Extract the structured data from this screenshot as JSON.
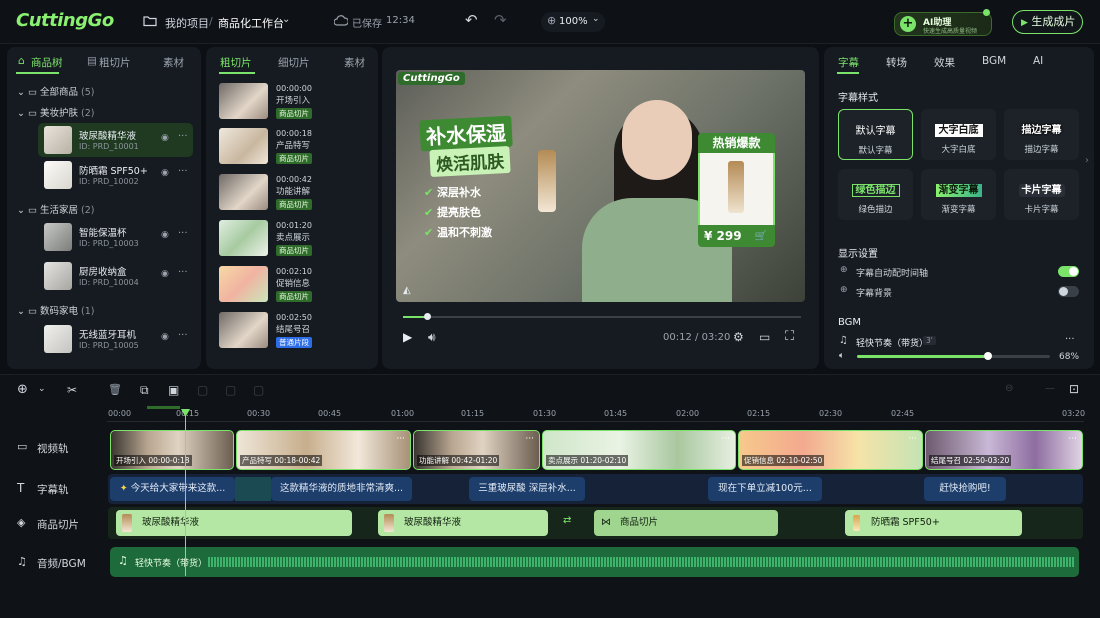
{
  "app": {
    "logo": "CuttingGo"
  },
  "topbar": {
    "project": "我的项目",
    "separator": "/",
    "workspace": "商品化工作台",
    "save_status": "已保存",
    "save_time": "12:34",
    "zoom": "100%",
    "ai_button_title": "AI助理",
    "ai_button_sub": "快速生成高质量视频",
    "generate_label": "生成成片"
  },
  "left_panel": {
    "tabs": [
      "商品树",
      "粗切片",
      "素材"
    ],
    "tree": [
      {
        "label": "全部商品",
        "count": "(5)"
      },
      {
        "label": "美妆护肤",
        "count": "(2)"
      },
      {
        "label": "生活家居",
        "count": "(2)"
      },
      {
        "label": "数码家电",
        "count": "(1)"
      }
    ],
    "products": [
      {
        "name": "玻尿酸精华液",
        "id": "ID: PRD_10001"
      },
      {
        "name": "防晒霜 SPF50+",
        "id": "ID: PRD_10002"
      },
      {
        "name": "智能保温杯",
        "id": "ID: PRD_10003"
      },
      {
        "name": "厨房收纳盒",
        "id": "ID: PRD_10004"
      },
      {
        "name": "无线蓝牙耳机",
        "id": "ID: PRD_10005"
      }
    ]
  },
  "clip_panel": {
    "tabs": [
      "粗切片",
      "细切片",
      "素材"
    ],
    "clips": [
      {
        "time": "00:00:00",
        "desc": "开场引入",
        "tag": "商品切片"
      },
      {
        "time": "00:00:18",
        "desc": "产品特写",
        "tag": "商品切片"
      },
      {
        "time": "00:00:42",
        "desc": "功能讲解",
        "tag": "商品切片"
      },
      {
        "time": "00:01:20",
        "desc": "卖点展示",
        "tag": "商品切片"
      },
      {
        "time": "00:02:10",
        "desc": "促销信息",
        "tag": "商品切片"
      },
      {
        "time": "00:02:50",
        "desc": "结尾号召",
        "tag": "普通片段"
      }
    ]
  },
  "preview": {
    "watermark": "CuttingGo",
    "headline1": "补水保湿",
    "headline2": "焕活肌肤",
    "bullets": [
      "深层补水",
      "提亮肤色",
      "温和不刺激"
    ],
    "hot_label": "热销爆款",
    "price": "¥ 299",
    "current_time": "00:12",
    "total_time": "03:20",
    "progress": 0.06
  },
  "right_panel": {
    "tabs": [
      "字幕",
      "转场",
      "效果",
      "BGM",
      "AI"
    ],
    "style_section": "字幕样式",
    "styles": [
      {
        "big": "默认字幕",
        "small": "默认字幕"
      },
      {
        "big": "大字白底",
        "small": "大字白底"
      },
      {
        "big": "描边字幕",
        "small": "描边字幕"
      },
      {
        "big": "绿色描边",
        "small": "绿色描边"
      },
      {
        "big": "渐变字幕",
        "small": "渐变字幕"
      },
      {
        "big": "卡片字幕",
        "small": "卡片字幕"
      }
    ],
    "display_section": "显示设置",
    "settings": [
      {
        "label": "字幕自动配时间轴",
        "on": true
      },
      {
        "label": "字幕背景",
        "on": false
      }
    ],
    "bgm_section": "BGM",
    "bgm_name": "轻快节奏（带货）",
    "bgm_duration": "3'",
    "volume": "68%"
  },
  "timeline": {
    "ticks": [
      "00:00",
      "00:15",
      "00:30",
      "00:45",
      "01:00",
      "01:15",
      "01:30",
      "01:45",
      "02:00",
      "02:15",
      "02:30",
      "02:45",
      "03:20"
    ],
    "tracks": [
      "视频轨",
      "字幕轨",
      "商品切片",
      "音频/BGM"
    ],
    "video_segments": [
      {
        "label": "开场引入 00:00-0:18"
      },
      {
        "label": "产品特写 00:18-00:42"
      },
      {
        "label": "功能讲解 00:42-01:20"
      },
      {
        "label": "卖点展示 01:20-02:10"
      },
      {
        "label": "促销信息 02:10-02:50"
      },
      {
        "label": "结尾号召 02:50-03:20"
      }
    ],
    "subtitles": [
      "今天给大家带来这款...",
      "这款精华液的质地非常清爽...",
      "三重玻尿酸 深层补水...",
      "现在下单立减100元...",
      "赶快抢购吧!"
    ],
    "product_clips": [
      "玻尿酸精华液",
      "玻尿酸精华液",
      "商品切片",
      "防晒霜 SPF50+"
    ],
    "audio": "轻快节奏（带货）"
  }
}
